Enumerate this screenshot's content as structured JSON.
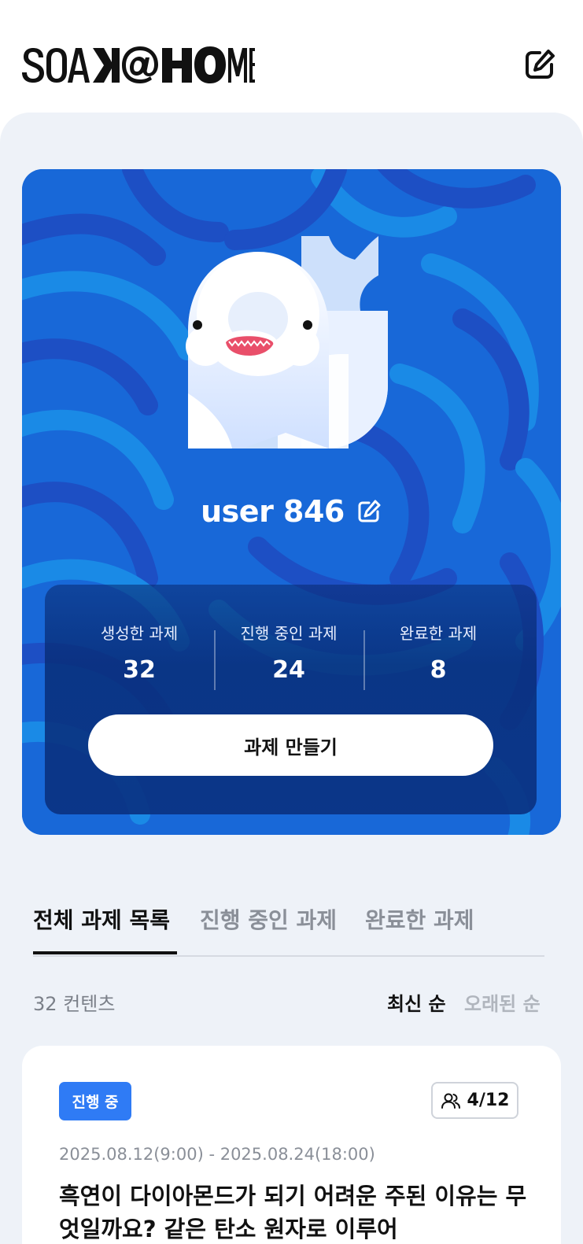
{
  "header": {
    "logo_text": "SOAK@HOME",
    "edit_icon": "edit-square-icon"
  },
  "profile": {
    "username": "user 846",
    "avatar": "beluga-whale-avatar",
    "edit_icon": "edit-square-icon",
    "stats": [
      {
        "label": "생성한 과제",
        "value": "32"
      },
      {
        "label": "진행 중인 과제",
        "value": "24"
      },
      {
        "label": "완료한 과제",
        "value": "8"
      }
    ],
    "create_button": "과제 만들기"
  },
  "tabs": [
    {
      "label": "전체 과제 목록",
      "active": true
    },
    {
      "label": "진행 중인 과제",
      "active": false
    },
    {
      "label": "완료한 과제",
      "active": false
    }
  ],
  "list": {
    "count_text": "32 컨텐츠",
    "sort_options": [
      {
        "label": "최신 순",
        "active": true
      },
      {
        "label": "오래된 순",
        "active": false
      }
    ]
  },
  "cards": [
    {
      "status": "진행 중",
      "members": "4/12",
      "members_icon": "people-icon",
      "date_range": "2025.08.12(9:00) - 2025.08.24(18:00)",
      "title": "흑연이 다이아몬드가 되기 어려운 주된 이유는 무엇일까요? 같은 탄소 원자로 이루어"
    }
  ],
  "colors": {
    "brand_blue": "#1868d8",
    "badge_blue": "#2f7bf5",
    "sheet_bg": "#eef2f8"
  }
}
